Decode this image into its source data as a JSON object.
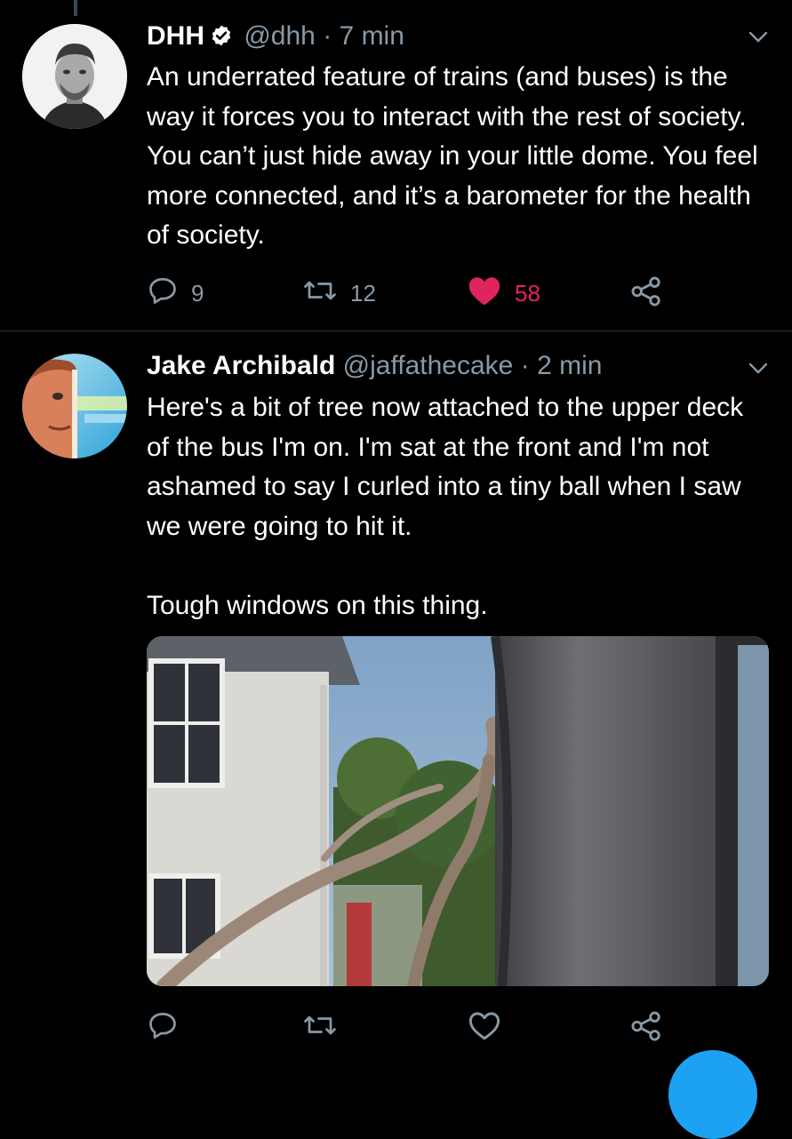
{
  "colors": {
    "background": "#000000",
    "text": "#ffffff",
    "muted": "#8899a6",
    "like": "#e0245e",
    "verified": "#ffffff",
    "fab": "#1da1f2"
  },
  "tweets": [
    {
      "display_name": "DHH",
      "handle": "@dhh",
      "separator": "·",
      "time": "7 min",
      "text": "An underrated feature of trains (and buses) is the way it forces you to interact with the rest of society. You can’t just hide away in your little dome. You feel more connected, and it’s a barometer for the health of society.",
      "replies": "9",
      "retweets": "12",
      "likes": "58",
      "liked": true,
      "verified": true
    },
    {
      "display_name": "Jake Archibald",
      "handle": "@jaffathecake",
      "separator": "·",
      "time": "2 min",
      "text": "Here's a bit of tree now attached to the upper deck of the bus I'm on. I'm sat at the front and I'm not ashamed to say I curled into a tiny ball when I saw we were going to hit it.\n\nTough windows on this thing.",
      "replies": "",
      "retweets": "",
      "likes": "",
      "liked": false,
      "verified": false
    }
  ],
  "icons": [
    "reply-icon",
    "retweet-icon",
    "like-icon",
    "share-icon",
    "chevron-down-icon",
    "verified-badge-icon"
  ]
}
